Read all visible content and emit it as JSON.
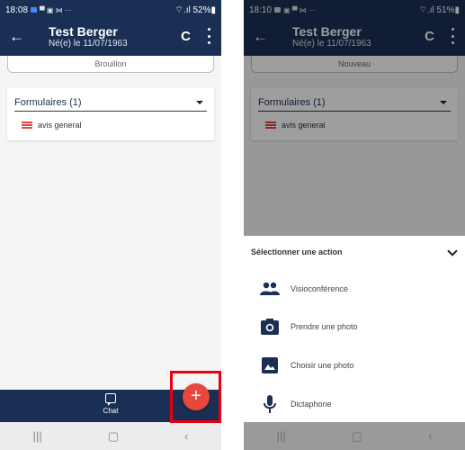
{
  "colors": {
    "primary": "#1a2f54",
    "fab": "#e8473c",
    "highlight": "#e8000f",
    "list_icon": "#e04848"
  },
  "screens": [
    {
      "status": {
        "time": "18:08",
        "notif": "▀ ▣ ⋈ ···",
        "signal": "⌔.ıl 52%▮"
      },
      "header": {
        "back": "←",
        "title": "Test Berger",
        "subtitle": "Né(e) le 11/07/1963",
        "refresh": "C"
      },
      "status_tab": "Brouillon",
      "forms": {
        "label": "Formulaires (1)",
        "items": [
          {
            "name": "avis general"
          }
        ]
      },
      "bottom_nav": {
        "chat": "Chat"
      },
      "fab": "+",
      "sysnav": [
        "|||",
        "▢",
        "‹"
      ]
    },
    {
      "status": {
        "time": "18:10",
        "notif": "▣ ▀ ⋈ ···",
        "signal": "⌔.ıl 51%▮"
      },
      "header": {
        "back": "←",
        "title": "Test Berger",
        "subtitle": "Né(e) le 11/07/1963",
        "refresh": "C"
      },
      "status_tab": "Nouveau",
      "forms": {
        "label": "Formulaires (1)",
        "items": [
          {
            "name": "avis general"
          }
        ]
      },
      "action_sheet": {
        "title": "Sélectionner une action",
        "actions": [
          {
            "label": "Visioconférence",
            "icon": "people-icon"
          },
          {
            "label": "Prendre une photo",
            "icon": "camera-icon"
          },
          {
            "label": "Choisir une photo",
            "icon": "image-icon"
          },
          {
            "label": "Dictaphone",
            "icon": "microphone-icon"
          }
        ]
      },
      "sysnav": [
        "|||",
        "▢",
        "‹"
      ]
    }
  ]
}
